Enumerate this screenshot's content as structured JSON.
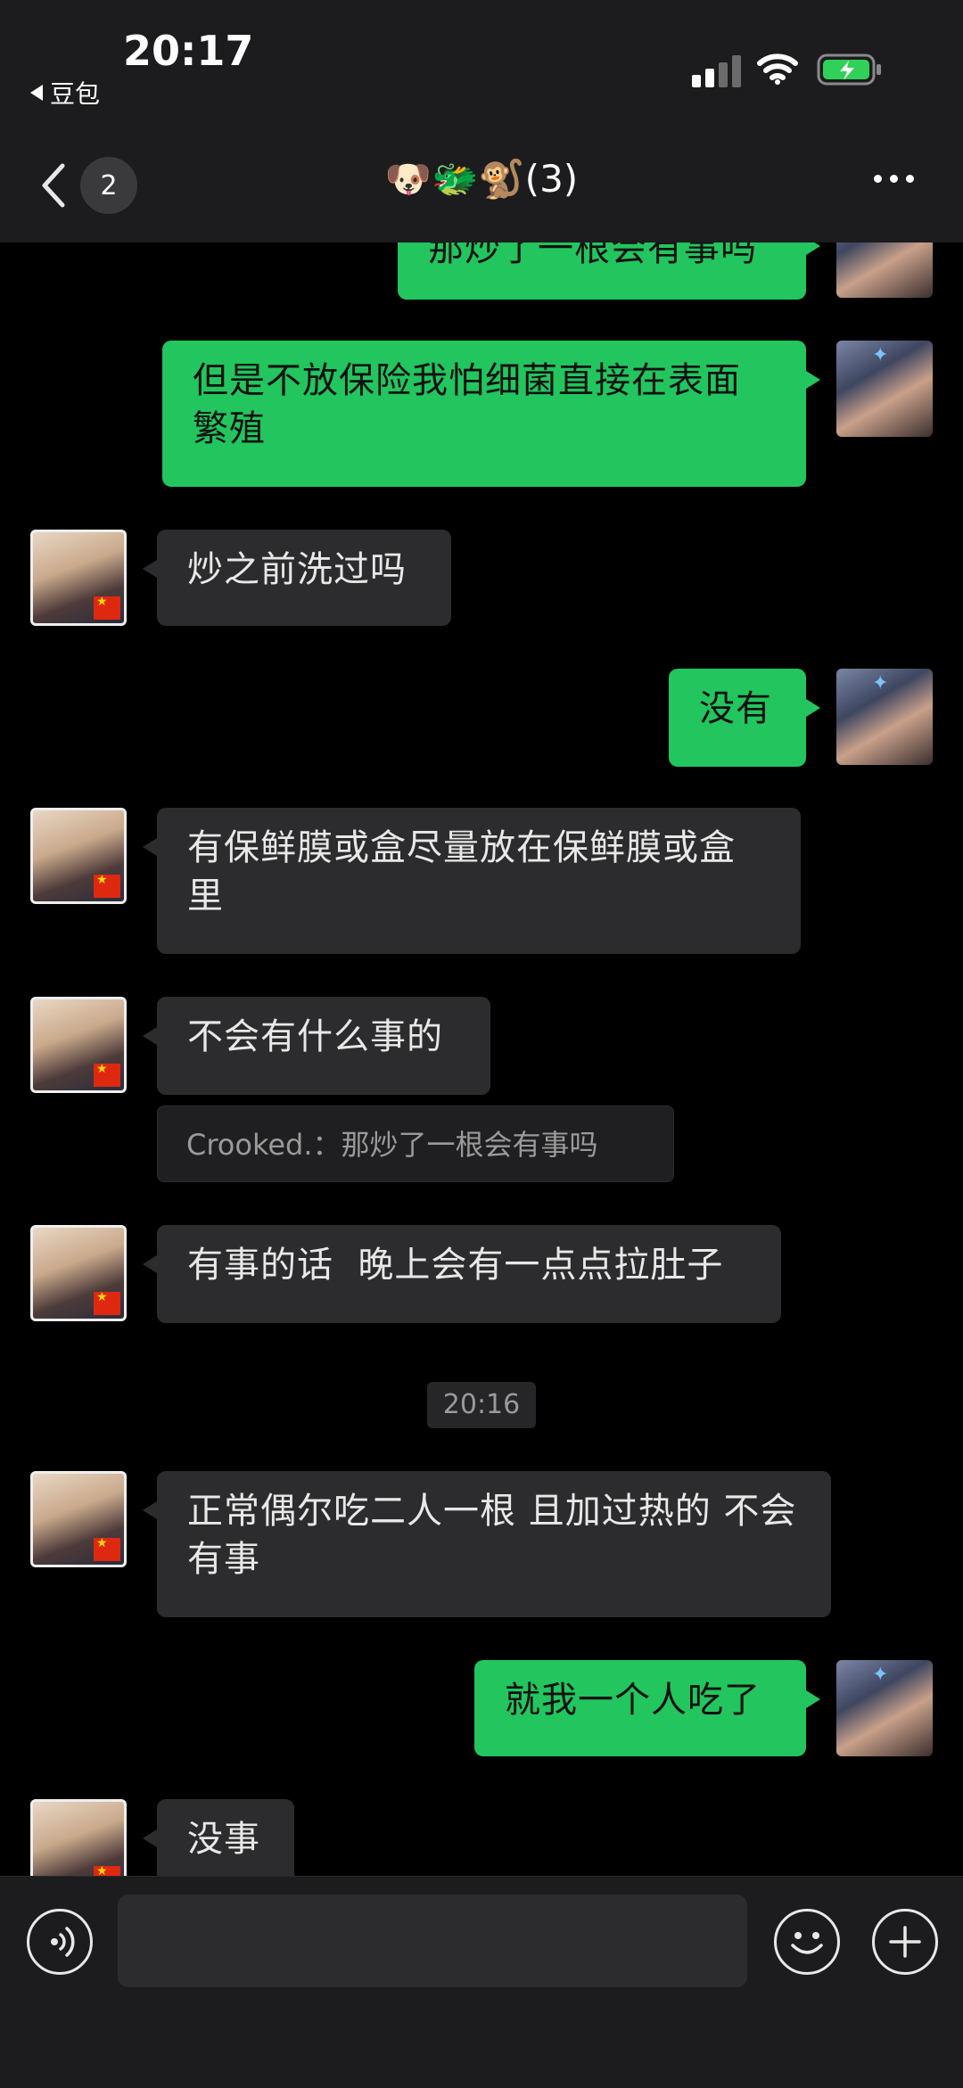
{
  "status_bar": {
    "time": "20:17",
    "back_app": "豆包"
  },
  "header": {
    "unread_count": "2",
    "title": "🐶🐲🐒(3)"
  },
  "messages": [
    {
      "sender": "self",
      "text": "那炒了一根会有事吗"
    },
    {
      "sender": "self",
      "text": "但是不放保险我怕细菌直接在表面繁殖"
    },
    {
      "sender": "other",
      "text": "炒之前洗过吗"
    },
    {
      "sender": "self",
      "text": "没有"
    },
    {
      "sender": "other",
      "text": "有保鲜膜或盒尽量放在保鲜膜或盒里"
    },
    {
      "sender": "other",
      "text": "不会有什么事的"
    },
    {
      "sender": "other",
      "text": "有事的话  晚上会有一点点拉肚子"
    },
    {
      "sender": "other",
      "text": "正常偶尔吃二人一根 且加过热的  不会有事"
    },
    {
      "sender": "self",
      "text": "就我一个人吃了"
    },
    {
      "sender": "other",
      "text": "没事"
    }
  ],
  "quote": {
    "text": "Crooked.：那炒了一根会有事吗"
  },
  "timestamp": "20:16",
  "input": {
    "placeholder": ""
  },
  "icons": {
    "back": "chevron-left-icon",
    "more": "more-dots-icon",
    "voice": "voice-icon",
    "emoji": "emoji-icon",
    "plus": "plus-icon"
  },
  "colors": {
    "self_bubble": "#22c55e",
    "other_bubble": "#2c2c2e",
    "background": "#000000"
  }
}
